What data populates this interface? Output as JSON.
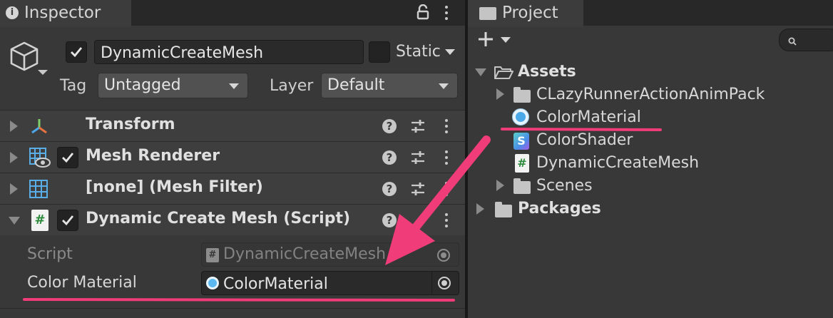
{
  "inspector": {
    "tab_label": "Inspector",
    "object_name": "DynamicCreateMesh",
    "static_label": "Static",
    "tag_label": "Tag",
    "tag_value": "Untagged",
    "layer_label": "Layer",
    "layer_value": "Default",
    "components": [
      {
        "label": "Transform"
      },
      {
        "label": "Mesh Renderer"
      },
      {
        "label": "[none] (Mesh Filter)"
      },
      {
        "label": "Dynamic Create Mesh (Script)"
      }
    ],
    "fields": [
      {
        "label": "Script",
        "value": "DynamicCreateMesh"
      },
      {
        "label": "Color Material",
        "value": "ColorMaterial"
      }
    ]
  },
  "project": {
    "tab_label": "Project",
    "tree": [
      {
        "label": "Assets"
      },
      {
        "label": "CLazyRunnerActionAnimPack"
      },
      {
        "label": "ColorMaterial"
      },
      {
        "label": "ColorShader"
      },
      {
        "label": "DynamicCreateMesh"
      },
      {
        "label": "Scenes"
      },
      {
        "label": "Packages"
      }
    ]
  },
  "annotation": {
    "color": "#f03c78"
  }
}
